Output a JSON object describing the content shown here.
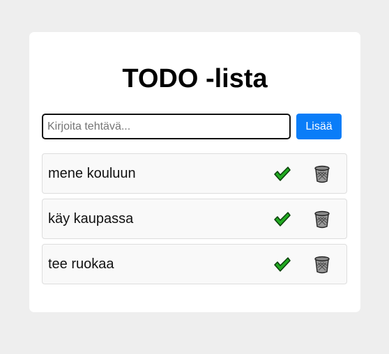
{
  "header": {
    "title": "TODO -lista"
  },
  "form": {
    "input_placeholder": "Kirjoita tehtävä...",
    "input_value": "",
    "add_label": "Lisää"
  },
  "tasks": [
    {
      "text": "mene kouluun"
    },
    {
      "text": "käy kaupassa"
    },
    {
      "text": "tee ruokaa"
    }
  ],
  "icons": {
    "done": "check-mark-icon",
    "delete": "trash-can-icon"
  },
  "colors": {
    "accent": "#0a7df8",
    "check": "#22aa22",
    "page_bg": "#eeeeee",
    "card_bg": "#ffffff",
    "item_bg": "#f9f9f9"
  }
}
